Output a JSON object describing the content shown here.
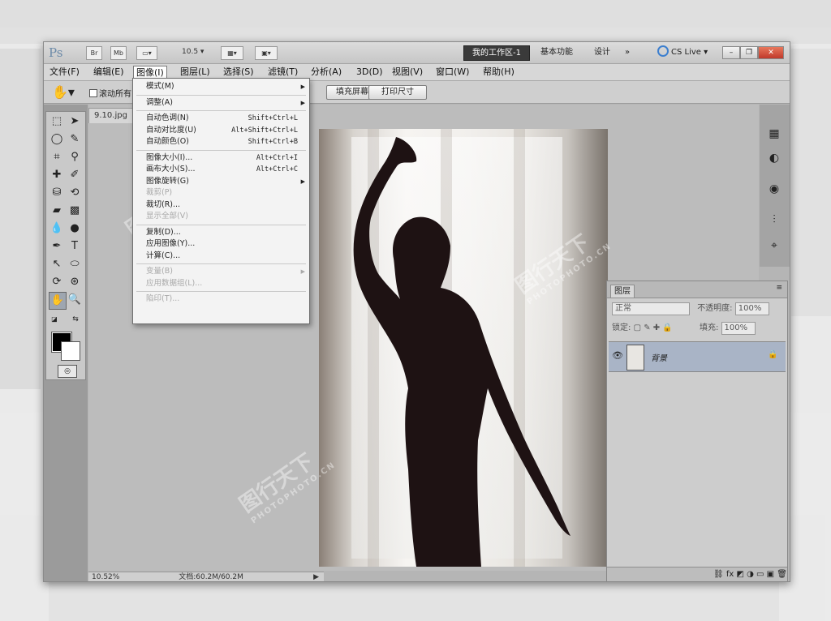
{
  "app": {
    "logo": "Ps",
    "toolbar_icons": [
      "Br",
      "Mb"
    ],
    "zoom_combo": "10.5",
    "workspace_active": "我的工作区-1",
    "workspace_links": [
      "基本功能",
      "设计",
      "»"
    ],
    "cs_live": "CS Live"
  },
  "menubar": [
    "文件(F)",
    "编辑(E)",
    "图像(I)",
    "图层(L)",
    "选择(S)",
    "滤镜(T)",
    "分析(A)",
    "3D(D)",
    "视图(V)",
    "窗口(W)",
    "帮助(H)"
  ],
  "options": {
    "scroll_all": "滚动所有",
    "buttons": [
      "填充屏幕",
      "打印尺寸"
    ]
  },
  "document": {
    "tab": "9.10.jpg",
    "status_zoom": "10.52%",
    "status_doc": "文档:60.2M/60.2M"
  },
  "image_menu": [
    {
      "label": "模式(M)",
      "shortcut": "",
      "submenu": true,
      "disabled": false
    },
    {
      "sep": true
    },
    {
      "label": "调整(A)",
      "shortcut": "",
      "submenu": true,
      "disabled": false
    },
    {
      "sep": true
    },
    {
      "label": "自动色调(N)",
      "shortcut": "Shift+Ctrl+L",
      "submenu": false,
      "disabled": false
    },
    {
      "label": "自动对比度(U)",
      "shortcut": "Alt+Shift+Ctrl+L",
      "submenu": false,
      "disabled": false
    },
    {
      "label": "自动颜色(O)",
      "shortcut": "Shift+Ctrl+B",
      "submenu": false,
      "disabled": false
    },
    {
      "sep": true
    },
    {
      "label": "图像大小(I)...",
      "shortcut": "Alt+Ctrl+I",
      "submenu": false,
      "disabled": false
    },
    {
      "label": "画布大小(S)...",
      "shortcut": "Alt+Ctrl+C",
      "submenu": false,
      "disabled": false
    },
    {
      "label": "图像旋转(G)",
      "shortcut": "",
      "submenu": true,
      "disabled": false
    },
    {
      "label": "裁剪(P)",
      "shortcut": "",
      "submenu": false,
      "disabled": true
    },
    {
      "label": "裁切(R)...",
      "shortcut": "",
      "submenu": false,
      "disabled": false
    },
    {
      "label": "显示全部(V)",
      "shortcut": "",
      "submenu": false,
      "disabled": true
    },
    {
      "sep": true
    },
    {
      "label": "复制(D)...",
      "shortcut": "",
      "submenu": false,
      "disabled": false
    },
    {
      "label": "应用图像(Y)...",
      "shortcut": "",
      "submenu": false,
      "disabled": false
    },
    {
      "label": "计算(C)...",
      "shortcut": "",
      "submenu": false,
      "disabled": false
    },
    {
      "sep": true
    },
    {
      "label": "变量(B)",
      "shortcut": "",
      "submenu": true,
      "disabled": true
    },
    {
      "label": "应用数据组(L)...",
      "shortcut": "",
      "submenu": false,
      "disabled": true
    },
    {
      "sep": true
    },
    {
      "label": "陷印(T)...",
      "shortcut": "",
      "submenu": false,
      "disabled": true
    }
  ],
  "layers_panel": {
    "tab": "图层",
    "blend_mode": "正常",
    "opacity_label": "不透明度:",
    "opacity_value": "100%",
    "lock_label": "锁定:",
    "fill_label": "填充:",
    "fill_value": "100%",
    "layer_name": "背景"
  },
  "watermark": {
    "text": "图行天下",
    "sub": "PHOTOPHOTO.CN"
  },
  "colors": {
    "foreground": "#000000",
    "background": "#ffffff",
    "workspace_button": "#3a3a3a",
    "layer_selected": "#a9b4c6"
  },
  "icons": {
    "tools": [
      "marquee-icon",
      "move-icon",
      "lasso-icon",
      "quick-select-icon",
      "crop-icon",
      "eyedropper-icon",
      "spot-heal-icon",
      "brush-icon",
      "clone-stamp-icon",
      "history-brush-icon",
      "eraser-icon",
      "gradient-icon",
      "blur-icon",
      "dodge-icon",
      "pen-icon",
      "type-icon",
      "path-select-icon",
      "shape-icon",
      "3d-rotate-icon",
      "3d-orbit-icon",
      "hand-icon",
      "zoom-icon"
    ],
    "dock": [
      "histogram-icon",
      "navigator-icon",
      "adjust-icon",
      "channels-icon",
      "paths-icon"
    ]
  }
}
